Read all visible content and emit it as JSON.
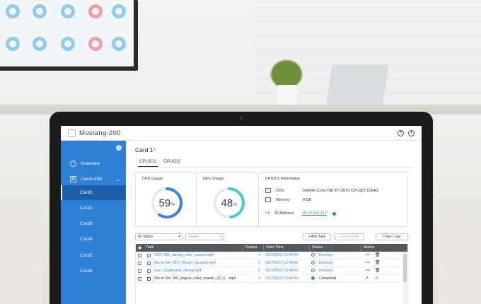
{
  "app": {
    "title": "Mustang-200"
  },
  "sidebar": {
    "overview": "Overview",
    "cards_info": "Cards Info",
    "cards": [
      "Card1",
      "Card2",
      "Card3",
      "Card4",
      "Card5",
      "Card6"
    ],
    "active_card_index": 0
  },
  "main": {
    "title": "Card 1",
    "tabs": [
      "CPUID1",
      "CPUID2"
    ],
    "active_tab": "CPUID1"
  },
  "cpu_usage": {
    "label": "CPU Usage",
    "value": 59,
    "unit": "%"
  },
  "gpu_usage": {
    "label": "GPU Usage",
    "value": 48,
    "unit": "%"
  },
  "cpuid_info": {
    "label": "CPUID1 Information",
    "cpu_label": "CPU",
    "cpu_value": "Intel(R) Core(TM) i5-7267U CPU@3.10GHz",
    "memory_label": "Memory",
    "memory_value": "8 GB",
    "ip_prefix": "0%",
    "ip_label": "IP Address",
    "ip_value": "10.10.102.117"
  },
  "toolbar": {
    "status_filter": "All Status",
    "search_placeholder": "Search",
    "add_task": "+ Add Task",
    "cancel_task": "Cancel Task",
    "clear_logs": "Clear Logs"
  },
  "table": {
    "columns": [
      "Task",
      "Output",
      "Start Time",
      "Status",
      "Action"
    ],
    "rows": [
      {
        "task": "VOD: 360_degree_roller_coaster.mp4",
        "output": "4",
        "start": "2017/05/17 15:44:09",
        "status": "Running"
      },
      {
        "task": "File to File: 2017_Beach_Vacation.mp4",
        "output": "2",
        "start": "2017/05/17 15:44:09",
        "status": "Running"
      },
      {
        "task": "Live: Countryside_Hiking.mp4",
        "output": "5",
        "start": "2017/05/17 15:44:09",
        "status": "Running"
      },
      {
        "task": "File to File: 360_degree_roller_coaster_V2_6....mp4",
        "output": "4",
        "start": "2017/05/17 15:44:09",
        "status": "Completed"
      }
    ]
  },
  "colors": {
    "sidebar": "#2f7fd6",
    "sidebar_active": "#1d5fa9",
    "accent": "#2f7fd6",
    "running": "#2f7fd6",
    "completed": "#3aa34a",
    "gauge_cpu": "#3d80e0",
    "gauge_gpu": "#4dc3d8"
  },
  "icons": {
    "help": "question-circle-icon",
    "info": "info-circle-icon",
    "edit": "pencil-icon",
    "search": "magnifier-icon"
  }
}
